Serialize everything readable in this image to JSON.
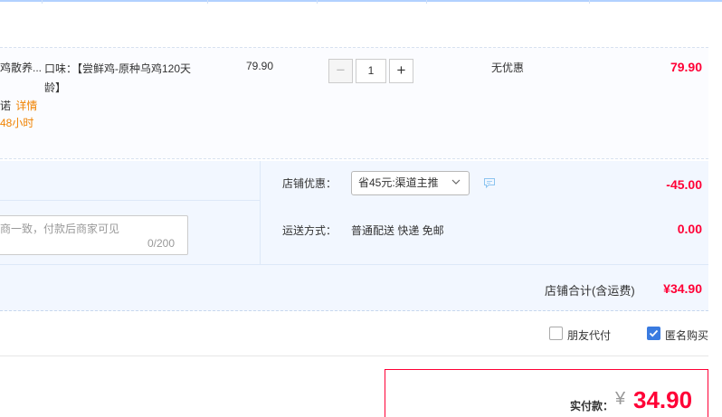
{
  "item": {
    "name": "鸡散养...",
    "tag_service": "诺",
    "tag_detail": "详情",
    "tag_time": "48小时",
    "spec": "口味：【尝鲜鸡-原种乌鸡120天龄】",
    "unit_price": "79.90",
    "quantity": "1",
    "quantity_minus": "−",
    "quantity_plus": "+",
    "discount": "无优惠",
    "total": "79.90"
  },
  "shop": {
    "message_placeholder": "商一致，付款后商家可见",
    "message_count": "0/200",
    "discount_label": "店铺优惠：",
    "discount_option": "省45元:渠道主推",
    "discount_amount": "-45.00",
    "shipping_label": "运送方式：",
    "shipping_value": "普通配送 快递 免邮",
    "shipping_amount": "0.00",
    "subtotal_label": "店铺合计(含运费)",
    "subtotal_value": "¥34.90"
  },
  "options": {
    "friend_pay": "朋友代付",
    "anonymous": "匿名购买",
    "friend_pay_checked": false,
    "anonymous_checked": true
  },
  "payment": {
    "label": "实付款：",
    "currency": "¥",
    "amount": "34.90"
  },
  "colors": {
    "accent": "#ff0036",
    "link": "#f08200",
    "checkbox": "#3a7be0"
  }
}
